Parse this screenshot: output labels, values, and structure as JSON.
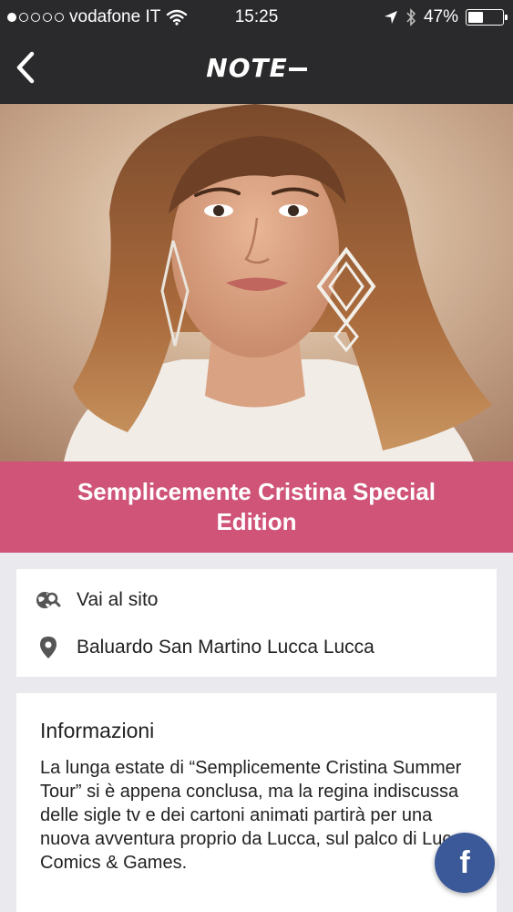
{
  "status_bar": {
    "signal_bars_filled": 1,
    "signal_bars_total": 5,
    "carrier": "vodafone IT",
    "time": "15:25",
    "battery_percent": "47%",
    "battery_level": 0.47,
    "icons": [
      "wifi-icon",
      "location-arrow-icon",
      "bluetooth-icon",
      "battery-icon"
    ]
  },
  "nav": {
    "back_icon": "chevron-left-icon",
    "logo_text": "NOTE"
  },
  "event": {
    "title": "Semplicemente Cristina Special Edition",
    "hero_image": "photo of the performer"
  },
  "links": {
    "website_label": "Vai al sito",
    "website_icon": "globe-search-icon",
    "location_label": "Baluardo San Martino Lucca Lucca",
    "location_icon": "map-pin-icon"
  },
  "info": {
    "heading": "Informazioni",
    "body": "La lunga estate di “Semplicemente Cristina Summer Tour” si è appena conclusa, ma la regina indiscussa delle sigle tv e dei cartoni animati partirà per una nuova avventura proprio da Lucca, sul palco di Lucca Comics & Games."
  },
  "fab": {
    "label": "f",
    "icon": "facebook-icon"
  },
  "colors": {
    "bar_background": "#2a2a2c",
    "title_banner": "#cf5478",
    "page_background": "#e9e9ee",
    "facebook": "#3b5998"
  }
}
